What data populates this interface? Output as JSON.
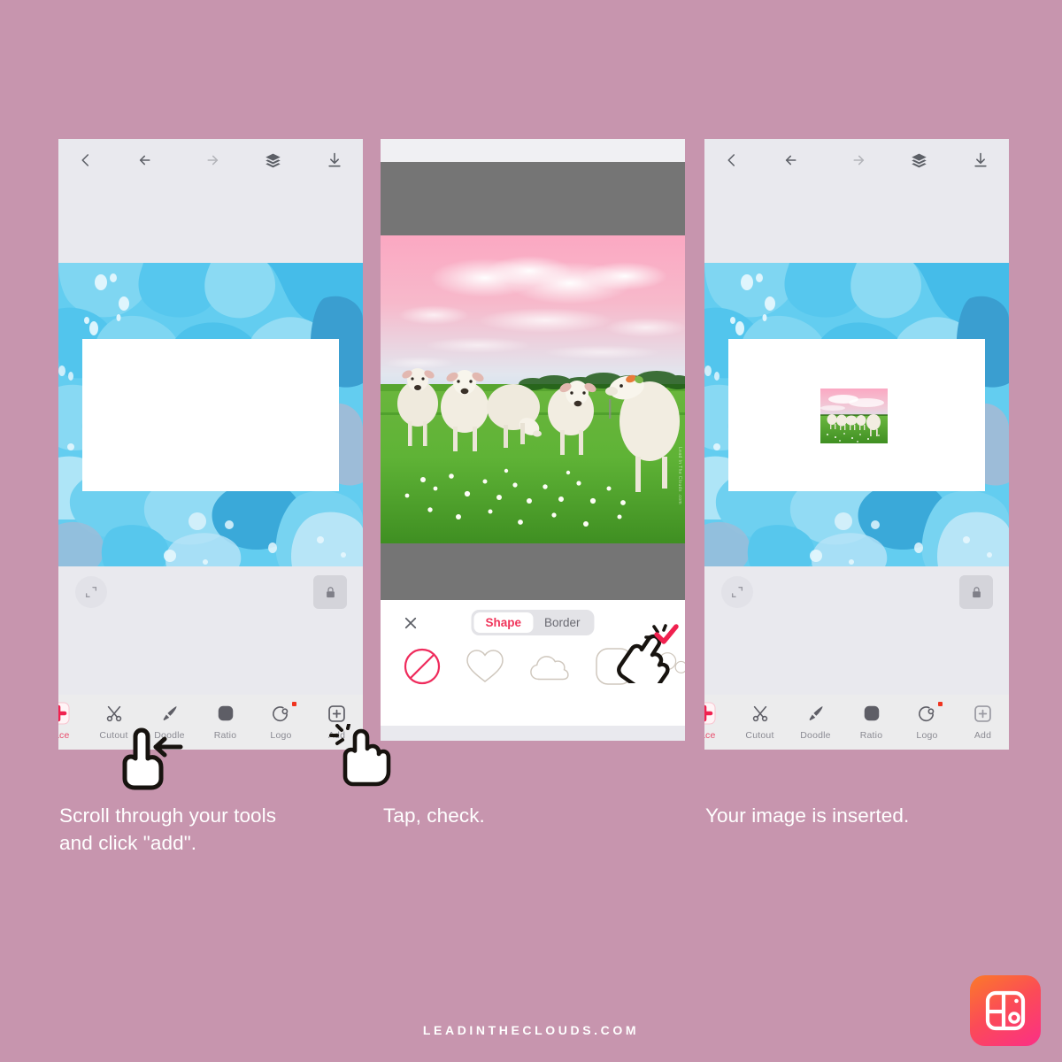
{
  "page": {
    "background_color": "#c795ae",
    "footer_text": "LEADINTHECLOUDS.COM",
    "accent_red": "#f0365c",
    "app_logo_name": "collage-maker-app-logo"
  },
  "captions": {
    "step1_line1": "Scroll through your tools",
    "step1_line2": "and click \"add\".",
    "step2": "Tap, check.",
    "step3": "Your image is inserted."
  },
  "topbar": {
    "back_icon": "chevron-left-icon",
    "undo_icon": "undo-arrow-icon",
    "redo_icon": "redo-arrow-icon",
    "layers_icon": "layers-icon",
    "download_icon": "download-icon"
  },
  "canvas": {
    "resize_icon": "resize-expand-icon",
    "lock_icon": "lock-closed-icon",
    "artwork_colors": {
      "base": "#63cdf0",
      "light": "#9ddff5",
      "pale": "#c7ecfa",
      "mid": "#45bfe8",
      "deep": "#3a9ed0",
      "steel": "#9dbcd8"
    }
  },
  "toolbar": {
    "items": [
      {
        "label": "place",
        "icon": "replace-plus-icon",
        "badge": false
      },
      {
        "label": "Cutout",
        "icon": "scissors-icon",
        "badge": false
      },
      {
        "label": "Doodle",
        "icon": "paintbrush-icon",
        "badge": false
      },
      {
        "label": "Ratio",
        "icon": "rounded-square-icon",
        "badge": false
      },
      {
        "label": "Logo",
        "icon": "logo-stamp-icon",
        "badge": true
      },
      {
        "label": "Add",
        "icon": "plus-in-square-icon",
        "badge": false
      }
    ]
  },
  "shape_panel": {
    "close_icon": "close-x-icon",
    "confirm_icon": "check-confirm-icon",
    "tabs": [
      {
        "label": "Shape",
        "selected": true
      },
      {
        "label": "Border",
        "selected": false
      }
    ],
    "shapes": [
      {
        "name": "no-shape-icon",
        "selected": true
      },
      {
        "name": "heart-shape-icon",
        "selected": false
      },
      {
        "name": "cloud-shape-icon",
        "selected": false
      },
      {
        "name": "squircle-shape-icon",
        "selected": false
      },
      {
        "name": "bubbles-shape-icon",
        "selected": false
      }
    ]
  },
  "photo": {
    "alt": "flock-of-sheep-in-green-meadow-under-pink-sky",
    "watermark": "Lead In The Clouds .com",
    "sky_top": "#f9a8c0",
    "sky_mid": "#dfe9f2",
    "sky_blue": "#8fc8e8",
    "grass": "#66b73a",
    "grass_dark": "#4e9c2b",
    "sheep": "#f3efe4"
  },
  "cursors": {
    "scroll_hand": "pointing-hand-scroll-left-icon",
    "tap_hand_add": "tapping-hand-icon",
    "tap_hand_confirm": "tapping-hand-icon"
  }
}
